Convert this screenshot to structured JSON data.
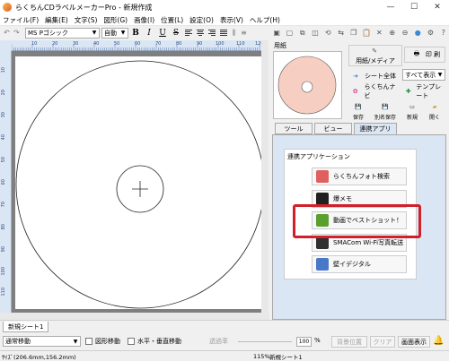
{
  "window": {
    "title": "らくちんCDラベルメーカーPro - 新規作成",
    "controls": [
      "—",
      "☐",
      "✕"
    ]
  },
  "menu": [
    "ファイル(F)",
    "編集(E)",
    "文字(S)",
    "図形(G)",
    "画像(I)",
    "位置(L)",
    "設定(O)",
    "表示(V)",
    "ヘルプ(H)"
  ],
  "toolbar": {
    "font_name": "MS Pゴシック",
    "font_size": "自動",
    "bold": "B",
    "italic": "I",
    "underline": "U",
    "strike": "S"
  },
  "rulers": {
    "horizontal": [
      "10",
      "20",
      "30",
      "40",
      "50",
      "60",
      "70",
      "80",
      "90",
      "100",
      "110",
      "120"
    ],
    "vertical": [
      "10",
      "20",
      "30",
      "40",
      "50",
      "60",
      "70",
      "80",
      "90",
      "100",
      "110"
    ]
  },
  "right_panel": {
    "paper_label": "用紙",
    "paper_media_button": "用紙/メディア",
    "print_button": "印 刷",
    "sheet_all_button": "シート全体",
    "view_select": "すべて表示",
    "navi_button": "らくちんナビ",
    "template_button": "テンプレート",
    "save_button": "保存",
    "save_as_button": "別名保存",
    "new_button": "新規",
    "open_button": "開く",
    "tabs": [
      "ツール",
      "ビュー",
      "連携アプリ"
    ],
    "active_tab": "連携アプリ",
    "group_title": "連携アプリケーション",
    "apps": [
      {
        "label": "らくちんフォト検索",
        "color": "#e06060"
      },
      {
        "label": "爆メモ",
        "color": "#202020"
      },
      {
        "label": "動画でベストショット！",
        "color": "#5aa02c"
      },
      {
        "label": "SMACom Wi-Fi写真転送",
        "color": "#303030"
      },
      {
        "label": "壁イデジタル",
        "color": "#4a78c8"
      }
    ],
    "highlight_color": "#d0202a"
  },
  "sheet_tab": "新規シート1",
  "status": {
    "mode": "通常移動",
    "shape_move": "図形移動",
    "hv_move": "水平・垂直移動",
    "transparency_label": "透過率",
    "zoom_value": "100",
    "zoom_unit": "%",
    "bg_position": "背景位置",
    "clear": "クリア",
    "screen_display": "画面表示"
  },
  "info": {
    "size": "ｻｲｽﾞ(206.6mm,156.2mm)",
    "zoom": "115%",
    "sheet": "新規シート1"
  }
}
